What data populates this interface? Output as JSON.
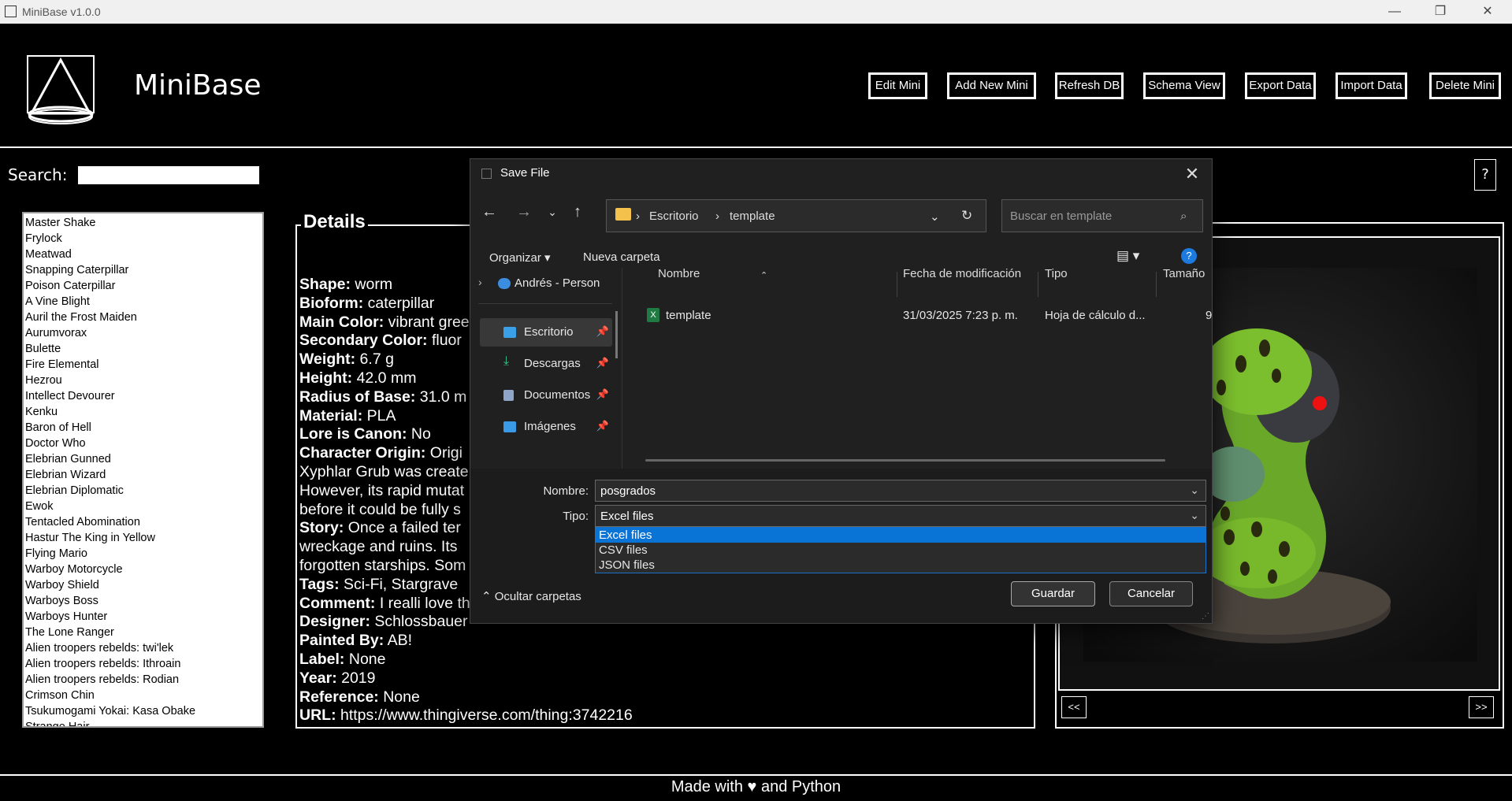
{
  "window": {
    "title": "MiniBase v1.0.0",
    "minimize": "—",
    "maximize": "❐",
    "close": "✕"
  },
  "header": {
    "app_name": "MiniBase",
    "buttons": [
      "Edit Mini",
      "Add New Mini",
      "Refresh DB",
      "Schema View",
      "Export Data",
      "Import Data",
      "Delete Mini"
    ]
  },
  "search": {
    "label": "Search:",
    "value": ""
  },
  "help_label": "?",
  "minis": [
    "Master Shake",
    "Frylock",
    "Meatwad",
    "Snapping Caterpillar",
    "Poison Caterpillar",
    "A Vine Blight",
    "Auril the Frost Maiden",
    "Aurumvorax",
    "Bulette",
    "Fire Elemental",
    "Hezrou",
    "Intellect Devourer",
    "Kenku",
    "Baron of Hell",
    "Doctor Who",
    "Elebrian Gunned",
    "Elebrian Wizard",
    "Elebrian Diplomatic",
    "Ewok",
    "Tentacled Abomination",
    "Hastur The King in Yellow",
    "Flying Mario",
    "Warboy Motorcycle",
    "Warboy Shield",
    "Warboys Boss",
    "Warboys Hunter",
    "The Lone Ranger",
    "Alien troopers rebelds: twi'lek",
    "Alien troopers rebelds: Ithroain",
    "Alien troopers rebelds: Rodian",
    "Crimson Chin",
    "Tsukumogami Yokai: Kasa Obake",
    "Strange Hair"
  ],
  "details": {
    "title": "Details",
    "lines": [
      {
        "k": "Shape:",
        "v": " worm"
      },
      {
        "k": "Bioform:",
        "v": " caterpillar"
      },
      {
        "k": "Main Color:",
        "v": " vibrant gree"
      },
      {
        "k": "Secondary Color:",
        "v": " fluor"
      },
      {
        "k": "Weight:",
        "v": " 6.7 g"
      },
      {
        "k": "Height:",
        "v": " 42.0 mm"
      },
      {
        "k": "Radius of Base:",
        "v": " 31.0 m"
      },
      {
        "k": "Material:",
        "v": " PLA"
      },
      {
        "k": "Lore is Canon:",
        "v": " No"
      },
      {
        "k": "Character Origin:",
        "v": " Origi"
      },
      {
        "k": "",
        "v": "Xyphlar Grub was create"
      },
      {
        "k": "",
        "v": "However, its rapid mutat"
      },
      {
        "k": "",
        "v": "before it could be fully s"
      },
      {
        "k": "Story:",
        "v": " Once a failed ter"
      },
      {
        "k": "",
        "v": "wreckage and ruins. Its"
      },
      {
        "k": "",
        "v": "forgotten starships. Som"
      },
      {
        "k": "Tags:",
        "v": " Sci-Fi, Stargrave"
      },
      {
        "k": "Comment:",
        "v": " I realli love th"
      },
      {
        "k": "Designer:",
        "v": " Schlossbauer"
      },
      {
        "k": "Painted By:",
        "v": " AB!"
      },
      {
        "k": "Label:",
        "v": " None"
      },
      {
        "k": "Year:",
        "v": " 2019"
      },
      {
        "k": "Reference:",
        "v": " None"
      },
      {
        "k": "URL:",
        "v": " https://www.thingiverse.com/thing:3742216"
      }
    ]
  },
  "image_nav": {
    "prev": "<<",
    "next": ">>"
  },
  "footer": "Made with ♥ and Python",
  "dialog": {
    "title": "Save File",
    "close": "✕",
    "path": [
      "Escritorio",
      "template"
    ],
    "search_placeholder": "Buscar en template",
    "organize": "Organizar ▾",
    "new_folder": "Nueva carpeta",
    "sidebar": [
      {
        "label": "Andrés - Person",
        "icon": "cloud-icon",
        "color": "#3b8de0"
      },
      {
        "label": "Escritorio",
        "icon": "desktop-icon",
        "color": "#3aa0e8",
        "selected": true
      },
      {
        "label": "Descargas",
        "icon": "download-icon",
        "color": "#3cc48a"
      },
      {
        "label": "Documentos",
        "icon": "document-icon",
        "color": "#8fa6c8"
      },
      {
        "label": "Imágenes",
        "icon": "image-icon",
        "color": "#3a9ae8"
      }
    ],
    "columns": [
      "Nombre",
      "Fecha de modificación",
      "Tipo",
      "Tamaño"
    ],
    "files": [
      {
        "name": "template",
        "modified": "31/03/2025 7:23 p. m.",
        "type": "Hoja de cálculo d...",
        "size": "9"
      }
    ],
    "name_label": "Nombre:",
    "name_value": "posgrados",
    "type_label": "Tipo:",
    "type_value": "Excel files",
    "type_options": [
      "Excel files",
      "CSV files",
      "JSON files"
    ],
    "hide_folders": "Ocultar carpetas",
    "save": "Guardar",
    "cancel": "Cancelar"
  }
}
